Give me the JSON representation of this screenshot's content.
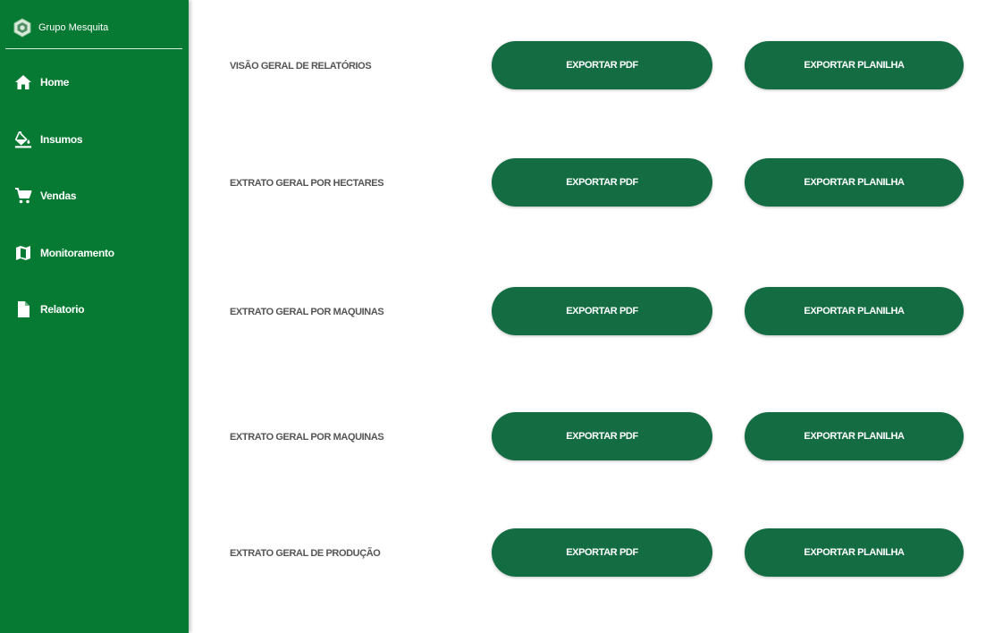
{
  "sidebar": {
    "brand": "Grupo Mesquita",
    "items": [
      {
        "label": "Home",
        "icon": "home-icon"
      },
      {
        "label": "Insumos",
        "icon": "paint-bucket-icon"
      },
      {
        "label": "Vendas",
        "icon": "shopping-cart-icon"
      },
      {
        "label": "Monitoramento",
        "icon": "map-icon"
      },
      {
        "label": "Relatorio",
        "icon": "file-icon"
      }
    ]
  },
  "reports": [
    {
      "label": "VISÃO GERAL DE RELATÓRIOS",
      "pdf": "EXPORTAR PDF",
      "sheet": "EXPORTAR PLANILHA"
    },
    {
      "label": "EXTRATO GERAL POR HECTARES",
      "pdf": "EXPORTAR PDF",
      "sheet": "EXPORTAR PLANILHA"
    },
    {
      "label": "EXTRATO GERAL POR MAQUINAS",
      "pdf": "EXPORTAR PDF",
      "sheet": "EXPORTAR PLANILHA"
    },
    {
      "label": "EXTRATO GERAL POR MAQUINAS",
      "pdf": "EXPORTAR PDF",
      "sheet": "EXPORTAR PLANILHA"
    },
    {
      "label": "EXTRATO GERAL DE PRODUÇÃO",
      "pdf": "EXPORTAR PDF",
      "sheet": "EXPORTAR PLANILHA"
    }
  ],
  "colors": {
    "sidebar": "#067a32",
    "button": "#146c43",
    "label_text": "#555555"
  }
}
